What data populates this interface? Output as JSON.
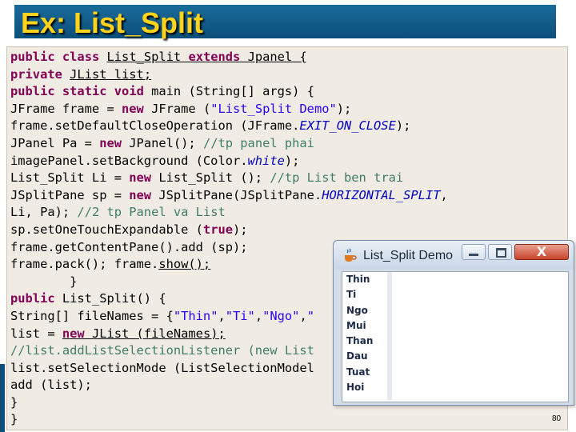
{
  "slide": {
    "title": "Ex: List_Split",
    "page_number": "80"
  },
  "code_lines": [
    "public class List_Split extends Jpanel {",
    "private JList list;",
    "public static void main (String[] args) {",
    "JFrame frame = new JFrame (\"List_Split Demo\");",
    "frame.setDefaultCloseOperation (JFrame.EXIT_ON_CLOSE);",
    "JPanel Pa = new JPanel(); //tp panel phai",
    "imagePanel.setBackground (Color.white);",
    "List_Split Li = new List_Split (); //tp List ben trai",
    "JSplitPane sp = new JSplitPane(JSplitPane.HORIZONTAL_SPLIT,",
    "Li, Pa); //2 tp Panel va List",
    "sp.setOneTouchExpandable (true);",
    "frame.getContentPane().add (sp);",
    "frame.pack(); frame.show();",
    "        }",
    "public List_Split() {",
    "String[] fileNames = {\"Thin\",\"Ti\",\"Ngo\",\"",
    "list = new JList (fileNames);",
    "//list.addListSelectionListener (new List",
    "list.setSelectionMode (ListSelectionModel",
    "add (list);",
    "}",
    "}"
  ],
  "demo_window": {
    "title": "List_Split Demo",
    "close_glyph": "X",
    "list_items": [
      "Thin",
      "Ti",
      "Ngo",
      "Mui",
      "Than",
      "Dau",
      "Tuat",
      "Hoi"
    ]
  },
  "colors": {
    "title_bar": "#0b4f7a",
    "title_text": "#ffd21c",
    "code_background": "#f1ece3",
    "keyword": "#7f0055",
    "string": "#2a00ff",
    "comment": "#3f7f5f",
    "constant": "#0000c0"
  }
}
